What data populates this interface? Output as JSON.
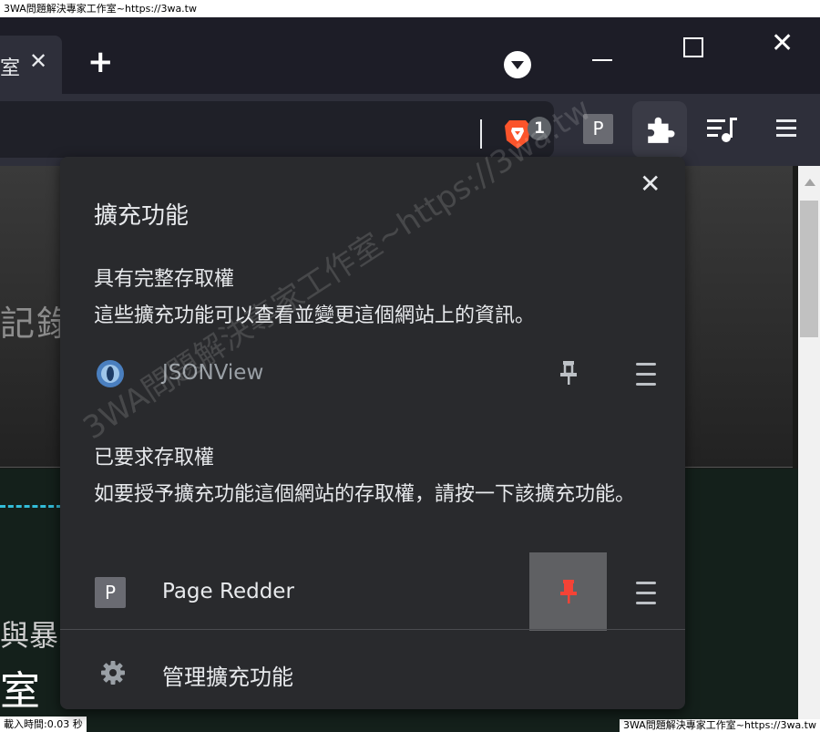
{
  "window": {
    "title": "3WA問題解決專家工作室~https://3wa.tw"
  },
  "tabs": {
    "active_tab_title": "室",
    "close_glyph": "✕",
    "new_tab_glyph": "+"
  },
  "toolbar": {
    "brave_badge_count": "1",
    "extension_p_label": "P"
  },
  "page": {
    "hero_text": "記錄",
    "bg_text_1": "與暴力",
    "bg_text_2": "室",
    "load_time": "載入時間:0.03 秒",
    "footer_right": "3WA問題解決專家工作室~https://3wa.tw"
  },
  "popup": {
    "title": "擴充功能",
    "close_glyph": "✕",
    "full_access": {
      "heading": "具有完整存取權",
      "description": "這些擴充功能可以查看並變更這個網站上的資訊。",
      "extensions": [
        {
          "name": "JSONView",
          "icon": "jsonview-icon",
          "pinned": false
        }
      ]
    },
    "requested_access": {
      "heading": "已要求存取權",
      "description": "如要授予擴充功能這個網站的存取權，請按一下該擴充功能。",
      "extensions": [
        {
          "name": "Page Redder",
          "icon_label": "P",
          "pinned": true
        }
      ]
    },
    "manage_label": "管理擴充功能"
  },
  "watermark": {
    "text": "3WA問題解決專家工作室~https://3wa.tw"
  },
  "colors": {
    "popup_bg": "#292a2d",
    "pin_active": "#f44336",
    "pin_highlight_bg": "#5f6063",
    "scrollbar_bg": "#f1f1f1"
  }
}
